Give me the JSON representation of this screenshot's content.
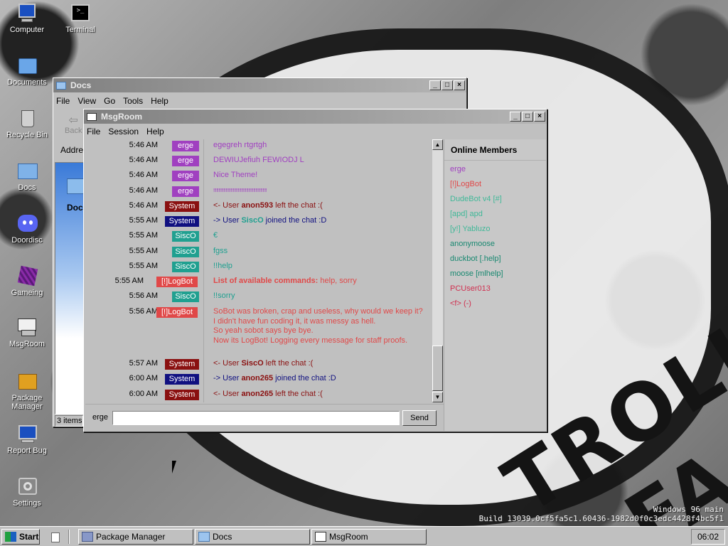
{
  "wallpaper": {
    "mark_top": "TROLL",
    "mark_bottom": "FA",
    "build_line1": "Windows 96 main",
    "build_line2": "Build 13039.0cf5fa5c1.60436-1982d0f0c3edc4428f4bc5f1"
  },
  "desktop_icons": [
    {
      "label": "Computer"
    },
    {
      "label": "Terminal"
    },
    {
      "label": "Documents"
    },
    {
      "label": "Recycle Bin"
    },
    {
      "label": "Docs"
    },
    {
      "label": "Doordisc"
    },
    {
      "label": "Gameing"
    },
    {
      "label": "MsgRoom"
    },
    {
      "label": "Package Manager"
    },
    {
      "label": "Report Bug"
    },
    {
      "label": "Settings"
    }
  ],
  "docs_window": {
    "title": "Docs",
    "menu": [
      "File",
      "View",
      "Go",
      "Tools",
      "Help"
    ],
    "back_label": "Back",
    "address_label": "Address",
    "folder_label": "Docs",
    "status": "3 items"
  },
  "msgroom": {
    "title": "MsgRoom",
    "menu": [
      "File",
      "Session",
      "Help"
    ],
    "members_title": "Online Members",
    "members": [
      {
        "name": "erge",
        "color": "#a040c0"
      },
      {
        "name": "[!]LogBot",
        "color": "#e04848"
      },
      {
        "name": "DudeBot v4 [#]",
        "color": "#40b898"
      },
      {
        "name": "[apd] apd",
        "color": "#40b898"
      },
      {
        "name": "[y!] Yabluzo",
        "color": "#40b898"
      },
      {
        "name": "anonymoose",
        "color": "#188870"
      },
      {
        "name": "duckbot [.help]",
        "color": "#188870"
      },
      {
        "name": "moose [mlhelp]",
        "color": "#188870"
      },
      {
        "name": "PCUser013",
        "color": "#d03050"
      },
      {
        "name": "<f> (-)",
        "color": "#d03050"
      }
    ],
    "messages": [
      {
        "time": "5:46 AM",
        "user": "erge",
        "text": "egegreh rtgrtgh"
      },
      {
        "time": "5:46 AM",
        "user": "erge",
        "text": "DEWIUJefiuh FEWIODJ L"
      },
      {
        "time": "5:46 AM",
        "user": "erge",
        "text": "Nice Theme!"
      },
      {
        "time": "5:46 AM",
        "user": "erge",
        "text": "!!!!!!!!!!!!!!!!!!!!!!!!!!!!!!!!!!!!!!!!!!!!!!!!!!!!"
      },
      {
        "time": "5:46 AM",
        "user": "System",
        "pre": "<- User ",
        "bold": "anon593",
        "post": " left the chat :("
      },
      {
        "time": "5:55 AM",
        "user": "System",
        "pre": "-> User ",
        "bold": "SiscO",
        "post": " joined the chat :D"
      },
      {
        "time": "5:55 AM",
        "user": "SiscO",
        "text": "€"
      },
      {
        "time": "5:55 AM",
        "user": "SiscO",
        "text": "fgss"
      },
      {
        "time": "5:55 AM",
        "user": "SiscO",
        "text": "!!help"
      },
      {
        "time": "5:55 AM",
        "user": "[!]LogBot",
        "pre": "",
        "bold": "List of available commands:",
        "post": " help, sorry"
      },
      {
        "time": "5:56 AM",
        "user": "SiscO",
        "text": "!!sorry"
      },
      {
        "time": "5:56 AM",
        "user": "[!]LogBot",
        "lines": [
          "SoBot was broken, crap and useless, why would we keep it?",
          "I didn't have fun coding it, it was messy as hell.",
          "So yeah sobot says bye bye.",
          "Now its LogBot! Logging every message for staff proofs."
        ]
      },
      {
        "time": "5:57 AM",
        "user": "System",
        "pre": "<- User ",
        "bold": "SiscO",
        "post": " left the chat :("
      },
      {
        "time": "6:00 AM",
        "user": "System",
        "pre": "-> User ",
        "bold": "anon265",
        "post": " joined the chat :D"
      },
      {
        "time": "6:00 AM",
        "user": "System",
        "pre": "<- User ",
        "bold": "anon265",
        "post": " left the chat :("
      }
    ],
    "nickname": "erge",
    "input_value": "",
    "send_label": "Send"
  },
  "taskbar": {
    "start_label": "Start",
    "items": [
      {
        "label": "Package Manager"
      },
      {
        "label": "Docs"
      },
      {
        "label": "MsgRoom"
      }
    ],
    "clock": "06:02"
  },
  "colors": {
    "erge": "#a040c0",
    "System_join": "#101080",
    "System_leave": "#8a1010",
    "SiscO": "#20a090",
    "LogBot": "#e04848"
  }
}
